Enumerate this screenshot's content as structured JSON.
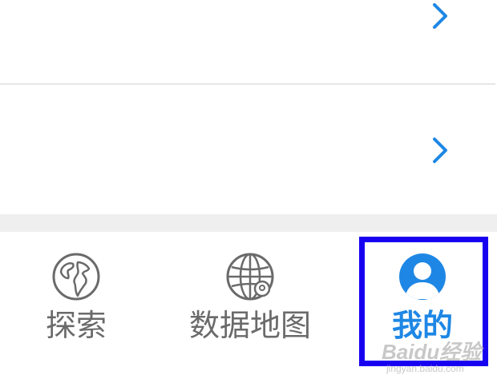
{
  "tabs": [
    {
      "label": "探索",
      "icon": "globe-icon",
      "active": false
    },
    {
      "label": "数据地图",
      "icon": "globe-grid-icon",
      "active": false
    },
    {
      "label": "我的",
      "icon": "user-icon",
      "active": true
    }
  ],
  "watermark": {
    "top": "Baidu经验",
    "bottom": "jingyan.baidu.com"
  },
  "colors": {
    "accent": "#1e87e5",
    "highlight": "#1800f0",
    "inactive_text": "#6a6a6a"
  }
}
